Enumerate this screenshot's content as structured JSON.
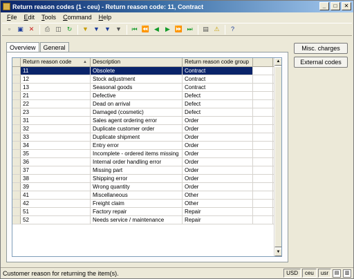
{
  "window": {
    "title": "Return reason codes (1 - ceu) - Return reason code: 11, Contract"
  },
  "menu": [
    {
      "label": "File",
      "u": "F",
      "rest": "ile"
    },
    {
      "label": "Edit",
      "u": "E",
      "rest": "dit"
    },
    {
      "label": "Tools",
      "u": "T",
      "rest": "ools"
    },
    {
      "label": "Command",
      "u": "C",
      "rest": "ommand"
    },
    {
      "label": "Help",
      "u": "H",
      "rest": "elp"
    }
  ],
  "tabs": [
    {
      "label": "Overview"
    },
    {
      "label": "General"
    }
  ],
  "grid": {
    "columns": [
      "Return reason code",
      "Description",
      "Return reason code group"
    ],
    "rows": [
      [
        "11",
        "Obsolete",
        "Contract"
      ],
      [
        "12",
        "Stock adjustment",
        "Contract"
      ],
      [
        "13",
        "Seasonal goods",
        "Contract"
      ],
      [
        "21",
        "Defective",
        "Defect"
      ],
      [
        "22",
        "Dead on arrival",
        "Defect"
      ],
      [
        "23",
        "Damaged (cosmetic)",
        "Defect"
      ],
      [
        "31",
        "Sales agent ordering error",
        "Order"
      ],
      [
        "32",
        "Duplicate customer order",
        "Order"
      ],
      [
        "33",
        "Duplicate shipment",
        "Order"
      ],
      [
        "34",
        "Entry error",
        "Order"
      ],
      [
        "35",
        "Incomplete - ordered items missing",
        "Order"
      ],
      [
        "36",
        "Internal order handling error",
        "Order"
      ],
      [
        "37",
        "Missing part",
        "Order"
      ],
      [
        "38",
        "Shipping error",
        "Order"
      ],
      [
        "39",
        "Wrong quantity",
        "Order"
      ],
      [
        "41",
        "Miscellaneous",
        "Other"
      ],
      [
        "42",
        "Freight claim",
        "Other"
      ],
      [
        "51",
        "Factory repair",
        "Repair"
      ],
      [
        "52",
        "Needs service / maintenance",
        "Repair"
      ]
    ]
  },
  "buttons": {
    "misc_charges": "Misc. charges",
    "external_codes": "External codes"
  },
  "status": {
    "text": "Customer reason for returning the item(s).",
    "currency": "USD",
    "company": "ceu",
    "user": "usr"
  }
}
